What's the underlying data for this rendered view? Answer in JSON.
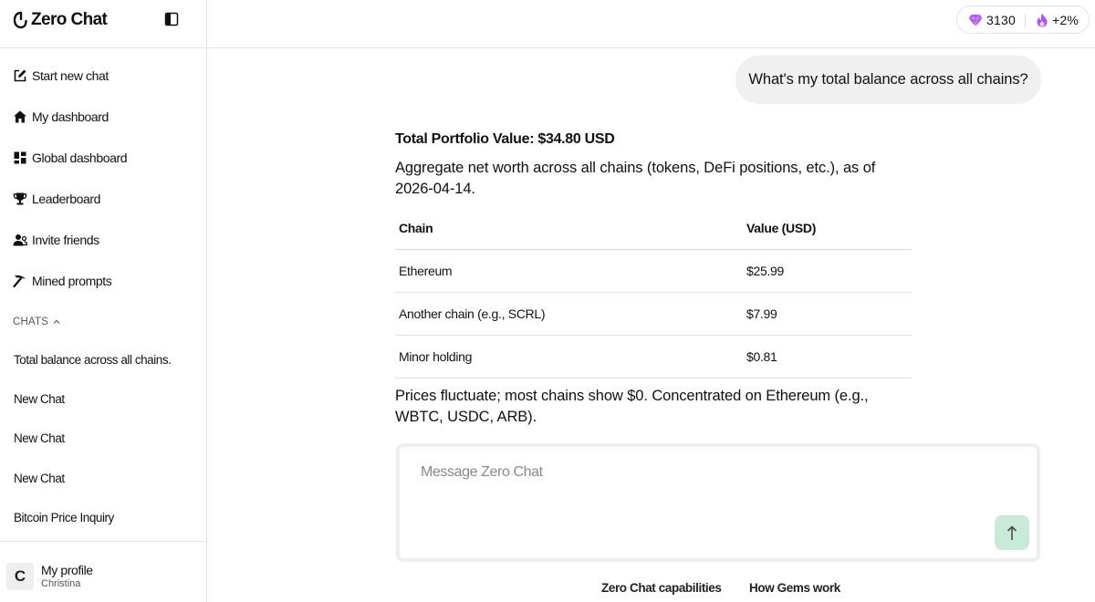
{
  "app": {
    "brand_name": "Zero Chat"
  },
  "sidebar": {
    "nav": [
      {
        "label": "Start new chat",
        "icon": "edit-icon"
      },
      {
        "label": "My dashboard",
        "icon": "home-icon"
      },
      {
        "label": "Global dashboard",
        "icon": "dashboard-grid-icon"
      },
      {
        "label": "Leaderboard",
        "icon": "trophy-icon"
      },
      {
        "label": "Invite friends",
        "icon": "invite-users-icon"
      },
      {
        "label": "Mined prompts",
        "icon": "pickaxe-icon"
      }
    ],
    "chats_label": "CHATS",
    "chats": [
      "Total balance across all chains.",
      "New Chat",
      "New Chat",
      "New Chat",
      "Bitcoin Price Inquiry"
    ],
    "profile": {
      "initial": "C",
      "name": "My profile",
      "username": "Christina"
    }
  },
  "header": {
    "gems": "3130",
    "boost": "+2%",
    "gem_icon": "gem-icon",
    "boost_icon": "flame-icon",
    "accent_gem": "#a855f7"
  },
  "conversation": {
    "user_message": "What's my total balance across all chains?",
    "answer": {
      "title": "Total Portfolio Value: $34.80 USD",
      "intro": "Aggregate net worth across all chains (tokens, DeFi positions, etc.), as of 2026-04-14.",
      "table": {
        "headers": [
          "Chain",
          "Value (USD)"
        ],
        "rows": [
          [
            "Ethereum",
            "$25.99"
          ],
          [
            "Another chain (e.g., SCRL)",
            "$7.99"
          ],
          [
            "Minor holding",
            "$0.81"
          ]
        ]
      },
      "outro": "Prices fluctuate; most chains show $0. Concentrated on Ethereum (e.g., WBTC, USDC, ARB)."
    }
  },
  "composer": {
    "placeholder": "Message Zero Chat",
    "send_icon": "arrow-up-icon",
    "send_color": "#c9ead7"
  },
  "footer": {
    "links": [
      "Zero Chat capabilities",
      "How Gems work"
    ]
  }
}
